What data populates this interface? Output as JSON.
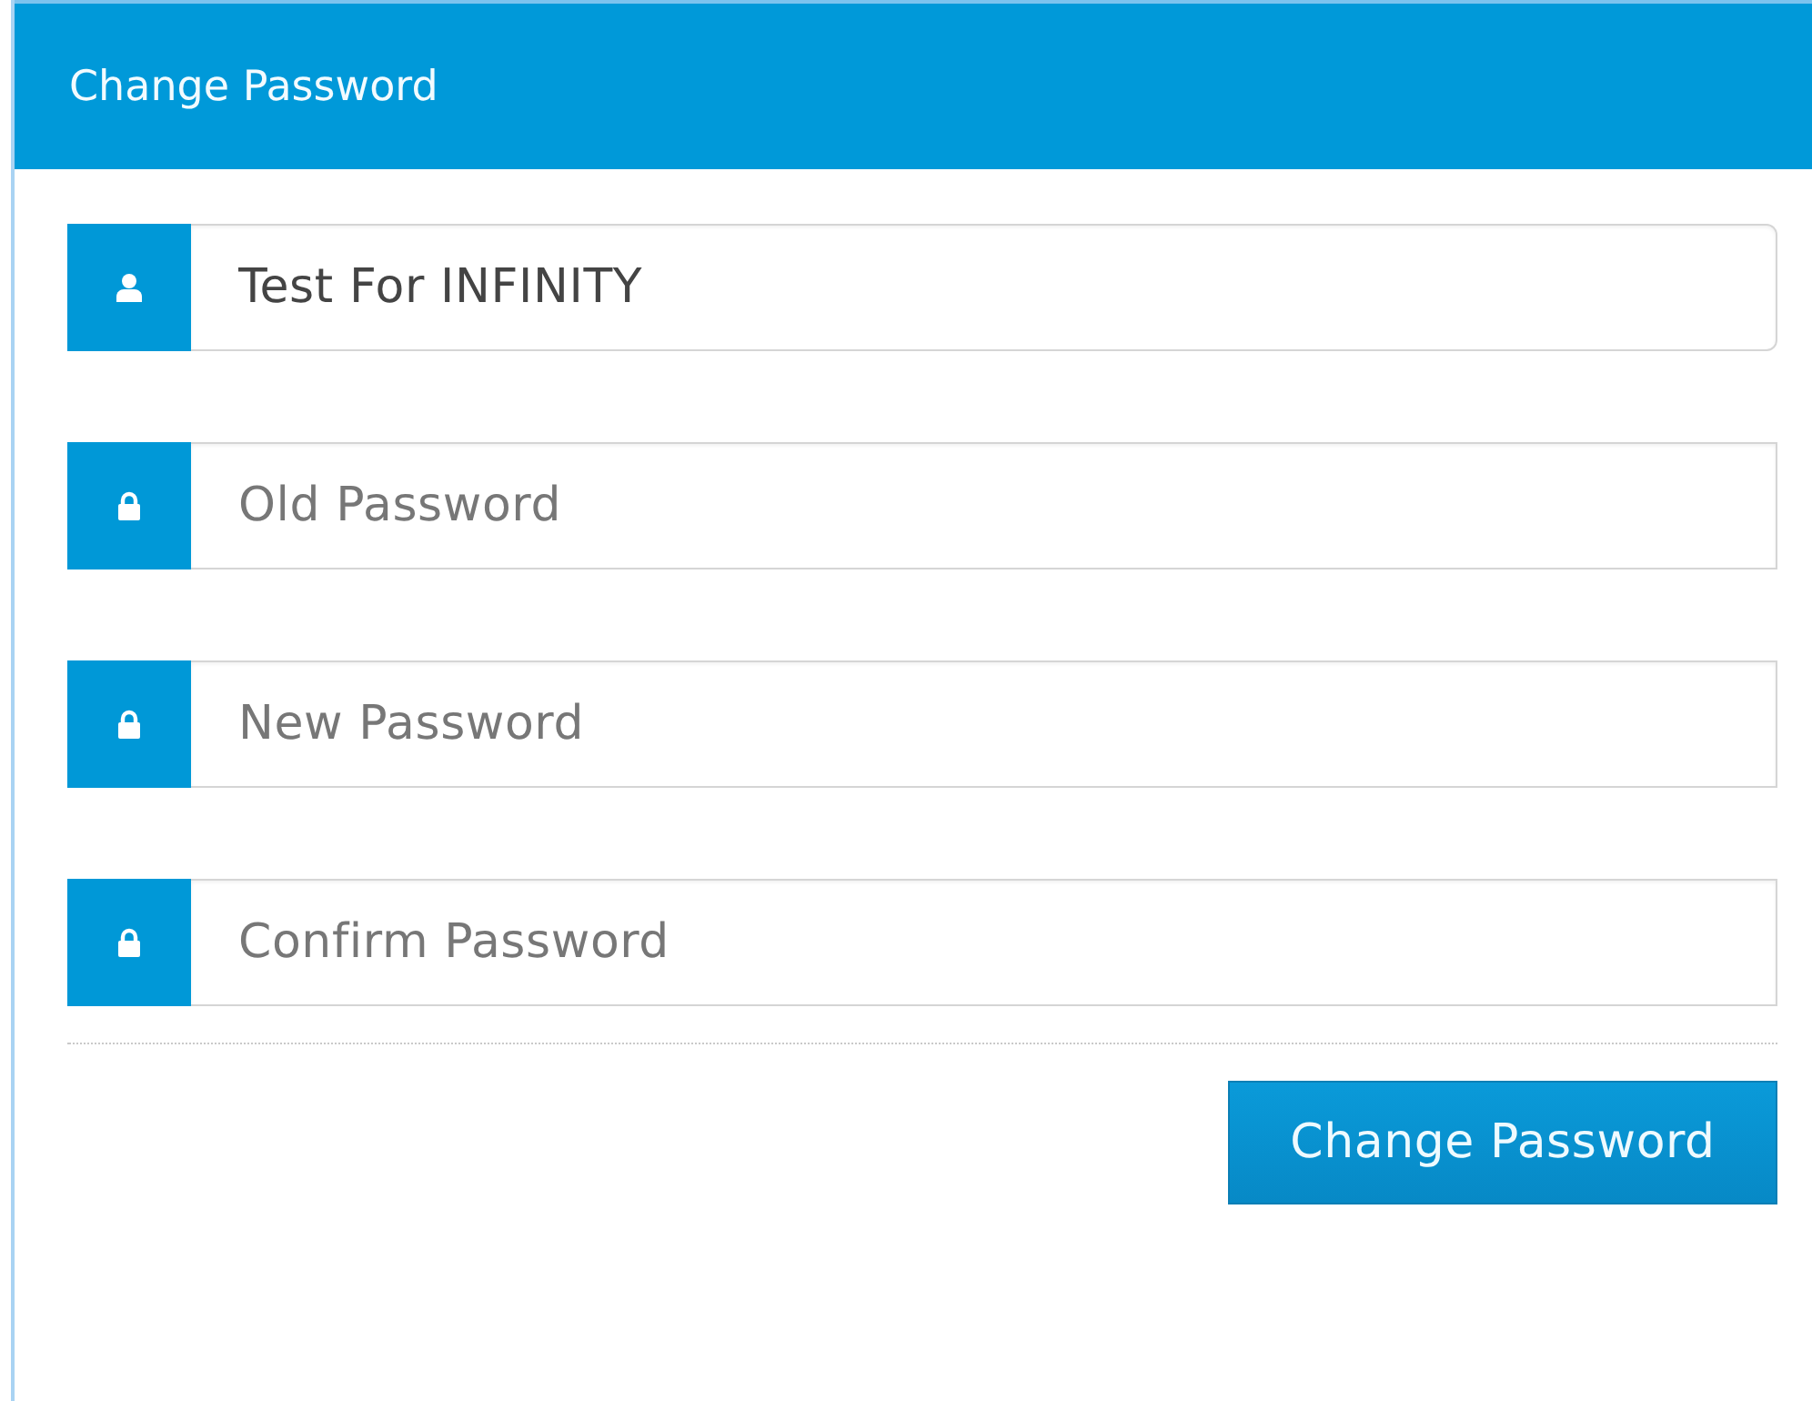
{
  "panel": {
    "title": "Change Password"
  },
  "fields": [
    {
      "kind": "user",
      "value": "Test For INFINITY"
    },
    {
      "kind": "lock",
      "placeholder": "Old Password"
    },
    {
      "kind": "lock",
      "placeholder": "New Password"
    },
    {
      "kind": "lock",
      "placeholder": "Confirm Password"
    }
  ],
  "submit_button": "Change Password"
}
